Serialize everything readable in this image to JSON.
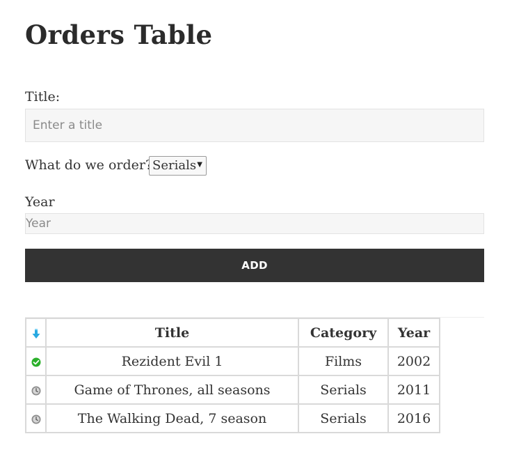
{
  "page": {
    "title": "Orders Table"
  },
  "form": {
    "title_label": "Title:",
    "title_placeholder": "Enter a title",
    "title_value": "",
    "order_label": "What do we order?",
    "order_selected": "Serials",
    "year_label": "Year",
    "year_placeholder": "Year",
    "year_value": "",
    "add_label": "ADD"
  },
  "table": {
    "sort_icon": "arrow-down-icon",
    "headers": {
      "title": "Title",
      "category": "Category",
      "year": "Year"
    },
    "rows": [
      {
        "status": "done",
        "status_icon": "check-circle-icon",
        "title": "Rezident Evil 1",
        "category": "Films",
        "year": "2002"
      },
      {
        "status": "pending",
        "status_icon": "clock-icon",
        "title": "Game of Thrones, all seasons",
        "category": "Serials",
        "year": "2011"
      },
      {
        "status": "pending",
        "status_icon": "clock-icon",
        "title": "The Walking Dead, 7 season",
        "category": "Serials",
        "year": "2016"
      }
    ]
  },
  "colors": {
    "button_bg": "#333333",
    "done_green": "#2bb02b",
    "pending_gray": "#8c8c8c",
    "sort_blue": "#29a9e1"
  }
}
